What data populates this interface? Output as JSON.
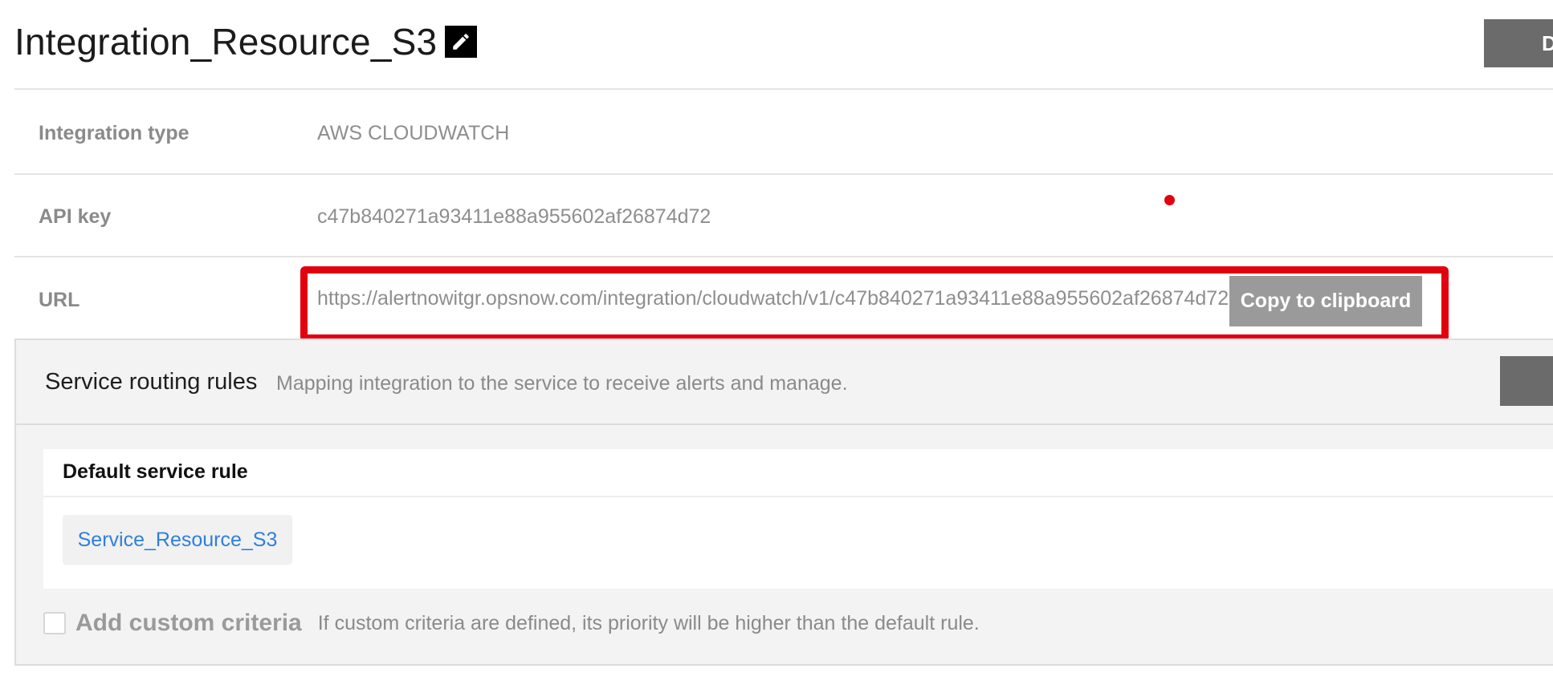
{
  "header": {
    "title": "Integration_Resource_S3",
    "edit_icon": "pencil-icon",
    "top_right_button_label": "D"
  },
  "details": {
    "integration_type": {
      "label": "Integration type",
      "value": "AWS CLOUDWATCH"
    },
    "api_key": {
      "label": "API key",
      "value": "c47b840271a93411e88a955602af26874d72"
    },
    "url": {
      "label": "URL",
      "value": "https://alertnowitgr.opsnow.com/integration/cloudwatch/v1/c47b840271a93411e88a955602af26874d72",
      "copy_button_label": "Copy to clipboard"
    }
  },
  "routing": {
    "title": "Service routing rules",
    "description": "Mapping integration to the service to receive alerts and manage.",
    "default_rule": {
      "title": "Default service rule",
      "service": "Service_Resource_S3"
    },
    "custom_criteria": {
      "label": "Add custom criteria",
      "description": "If custom criteria are defined, its priority will be higher than the default rule.",
      "checked": false
    }
  },
  "colors": {
    "highlight_border": "#e2000f",
    "link": "#2f7fdc",
    "button_gray": "#9a9a9a",
    "dark_button": "#6b6b6b"
  }
}
